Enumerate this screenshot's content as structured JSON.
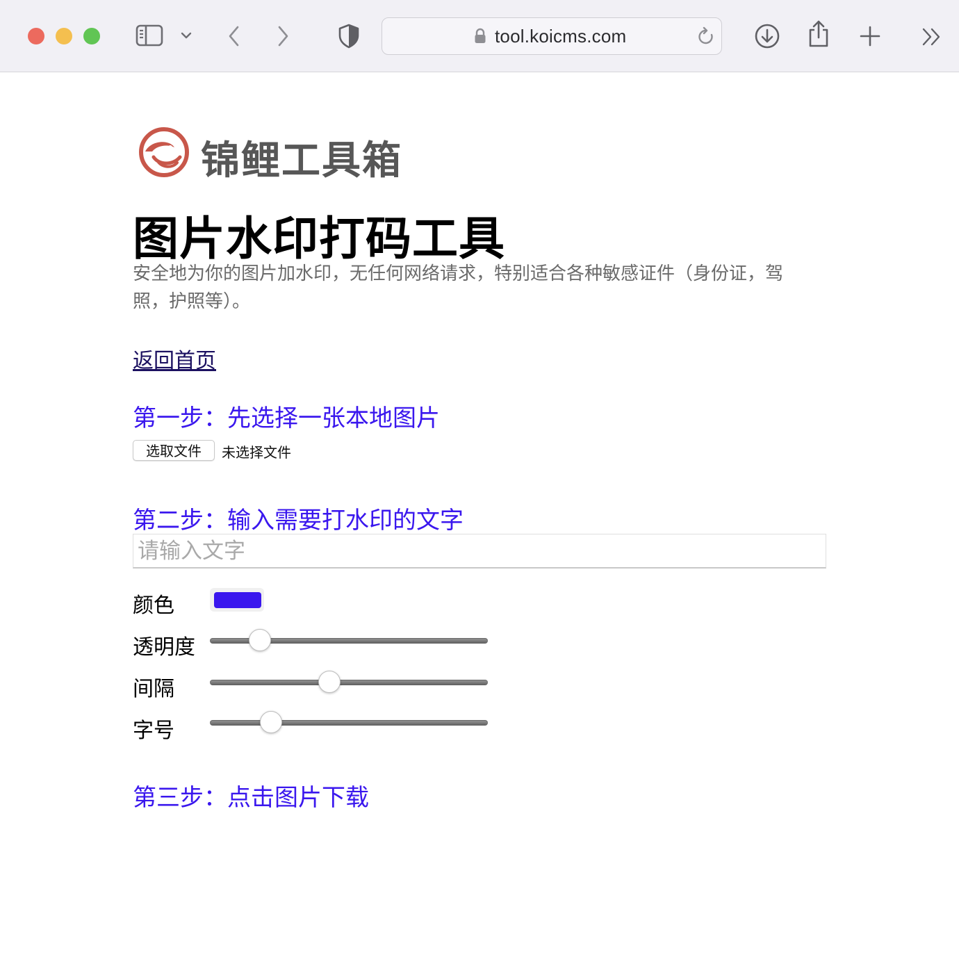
{
  "browser": {
    "url": "tool.koicms.com",
    "icons": [
      "sidebar-icon",
      "chevron-down-icon",
      "back-icon",
      "forward-icon",
      "shield-icon",
      "lock-icon",
      "reload-icon",
      "download-icon",
      "share-icon",
      "new-tab-icon",
      "more-icon"
    ]
  },
  "site": {
    "logo_text": "锦鲤工具箱",
    "logo_color": "#c8574a"
  },
  "page": {
    "title": "图片水印打码工具",
    "description": "安全地为你的图片加水印，无任何网络请求，特别适合各种敏感证件（身份证，驾照，护照等）。",
    "home_link": "返回首页"
  },
  "step1": {
    "heading": "第一步：先选择一张本地图片",
    "file_button": "选取文件",
    "file_status": "未选择文件"
  },
  "step2": {
    "heading": "第二步：输入需要打水印的文字",
    "input_value": "",
    "input_placeholder": "请输入文字",
    "color_label": "颜色",
    "color_value": "#3a17ee",
    "opacity_label": "透明度",
    "opacity_value": 0.18,
    "spacing_label": "间隔",
    "spacing_value": 0.43,
    "fontsize_label": "字号",
    "fontsize_value": 0.22
  },
  "step3": {
    "heading": "第三步：点击图片下载"
  },
  "colors": {
    "step_heading": "#3a17ee",
    "link": "#1b1060",
    "description": "#6a6a6a"
  }
}
